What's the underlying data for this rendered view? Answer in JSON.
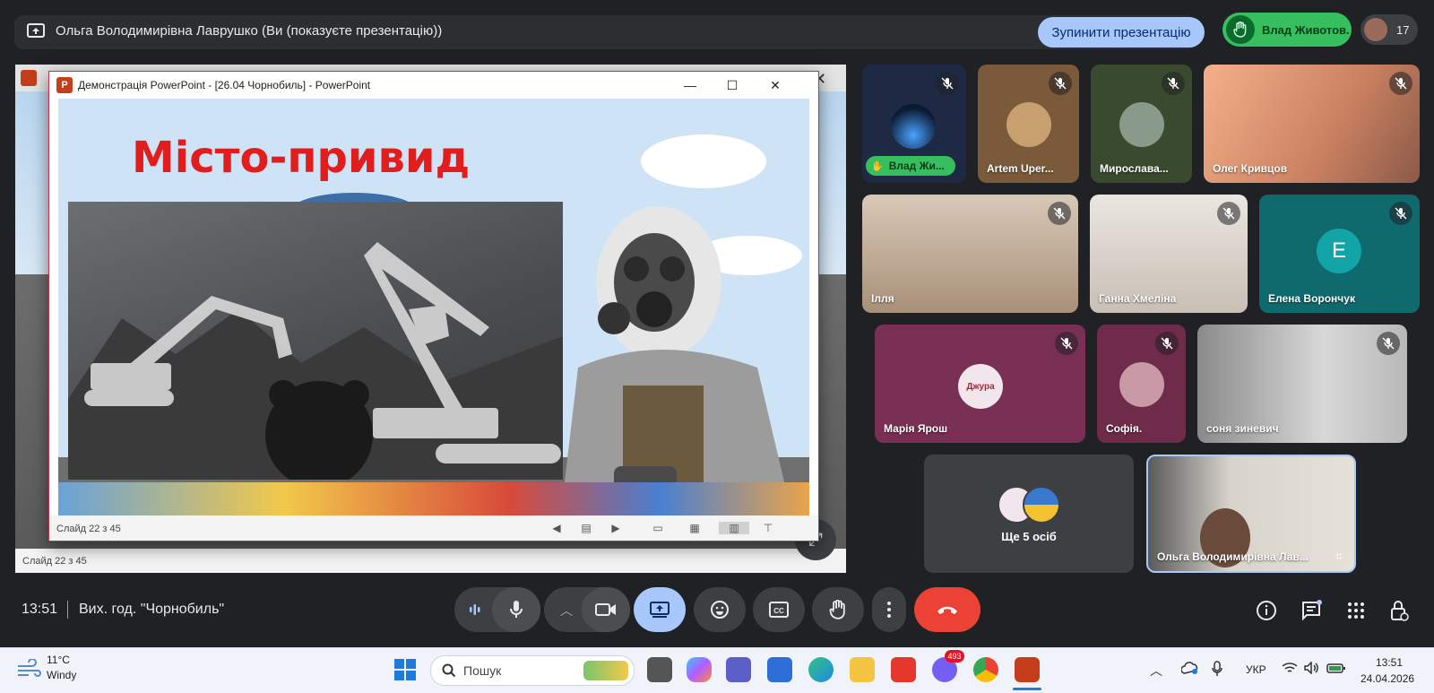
{
  "top_bar": {
    "presenter_text": "Ольга Володимирівна Лаврушко (Ви (показуєте презентацію))",
    "stop_button": "Зупинити презентацію",
    "raised_hand_name": "Влад Животов.",
    "participant_count": "17"
  },
  "powerpoint": {
    "window_title": "Демонстрація PowerPoint - [26.04 Чорнобиль] - PowerPoint",
    "slide_heading": "Місто-привид",
    "slide_status": "Слайд 22 з 45",
    "background_slide_status": "Слайд 22 з 45"
  },
  "tiles": [
    {
      "name": "Влад Жи...",
      "raised_hand": true
    },
    {
      "name": "Artem Uper..."
    },
    {
      "name": "Мирослава..."
    },
    {
      "name": "Олег Кривцов"
    },
    {
      "name": "Ілля"
    },
    {
      "name": "Ганна Хмеліна"
    },
    {
      "name": "Елена Ворончук",
      "initial": "E"
    },
    {
      "name": "Марія Ярош",
      "logo_text": "Джура"
    },
    {
      "name": "Софія."
    },
    {
      "name": "соня зиневич"
    },
    {
      "name": "Ще 5 осіб"
    },
    {
      "name": "Ольга Володимирівна Лав..."
    }
  ],
  "meeting_bar": {
    "time": "13:51",
    "meeting_name": "Вих. год. \"Чорнобиль\""
  },
  "taskbar": {
    "weather_temp": "11°C",
    "weather_desc": "Windy",
    "search_placeholder": "Пошук",
    "viber_badge": "493",
    "language": "УКР",
    "time": "13:51",
    "date": "24.04.2026"
  },
  "colors": {
    "meet_bg": "#202124",
    "stop_button_bg": "#a8c7fa",
    "raised_hand_bg": "#37be5f",
    "end_call_red": "#ea4335",
    "active_present_bg": "#a8c7fa",
    "slide_heading_red": "#e21d1d"
  }
}
